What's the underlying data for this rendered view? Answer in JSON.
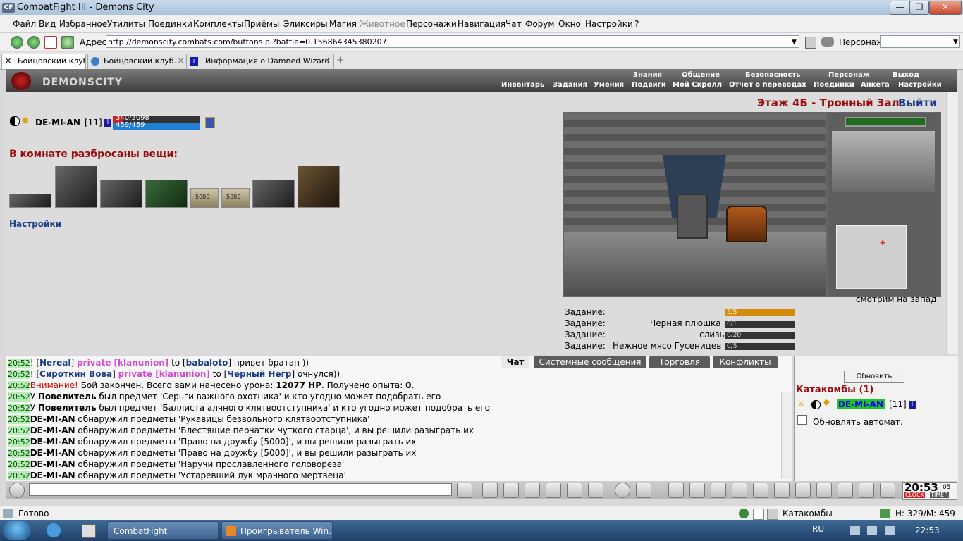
{
  "window": {
    "title": "CombatFight III - Demons City",
    "logo_text": "CF",
    "minimize": "—",
    "maximize": "❐",
    "close": "✕"
  },
  "menu": [
    "Файл",
    "Вид",
    "Избранное",
    "Утилиты",
    "Поединки",
    "Комплекты",
    "Приёмы",
    "Эликсиры",
    "Магия",
    "Животное",
    "Персонажи",
    "Навигация",
    "Чат",
    "Форум",
    "Окно",
    "Настройки",
    "?"
  ],
  "address": {
    "label": "Адрес:",
    "url": "http://demonscity.combats.com/buttons.pl?battle=0.156864345380207",
    "char_label": "Персонаж:"
  },
  "tabs": [
    "Бойцовский клуб",
    "Бойцовский клуб.",
    "Информация о Damned Wizard"
  ],
  "game_header": {
    "logo": "DEMONSCITY",
    "top_links": [
      "Знания",
      "Общение",
      "Безопасность",
      "Персонаж",
      "Выход"
    ],
    "bottom_links": [
      "Инвентарь",
      "Задания",
      "Умения",
      "Подвиги",
      "Мой Скролл",
      "Отчет о переводах",
      "Поединки",
      "Анкета",
      "Настройки"
    ]
  },
  "character": {
    "name": "DE-MI-AN",
    "level": "[11]",
    "hp_text": "340/3098",
    "hp_fraction": 0.11,
    "mp_text": "459/459",
    "info_icon": "i"
  },
  "room": {
    "title": "В комнате разбросаны вещи:",
    "settings_link": "Настройки",
    "scroll_label": "5000"
  },
  "location": {
    "name": "Этаж 4Б - Тронный Зал",
    "exit": "Выйти",
    "facing": "смотрим на запад"
  },
  "tasks": [
    {
      "label": "Задание:",
      "name": "",
      "progress": "5/5",
      "fraction": 1.0
    },
    {
      "label": "Задание:",
      "name": "Черная плюшка",
      "progress": "0/1",
      "fraction": 0
    },
    {
      "label": "Задание:",
      "name": "слизь",
      "progress": "0/20",
      "fraction": 0
    },
    {
      "label": "Задание:",
      "name": "Нежное мясо Гусеницев",
      "progress": "0/5",
      "fraction": 0
    }
  ],
  "chat_tabs": [
    "Чат",
    "Системные сообщения",
    "Торговля",
    "Конфликты"
  ],
  "chat": [
    {
      "time": "20:52",
      "parts": [
        [
          "! [",
          ""
        ],
        [
          "Nereal",
          "bold-blue"
        ],
        [
          "] ",
          ""
        ],
        [
          "private [klanunion]",
          "pink"
        ],
        [
          " to [",
          ""
        ],
        [
          "babaloto",
          "bold-blue"
        ],
        [
          "] привет братан ))",
          ""
        ]
      ]
    },
    {
      "time": "20:52",
      "parts": [
        [
          "! [",
          ""
        ],
        [
          "Сироткин Вова",
          "bold-blue"
        ],
        [
          "] ",
          ""
        ],
        [
          "private [klanunion]",
          "pink"
        ],
        [
          " to [",
          ""
        ],
        [
          "Черный Негр",
          "bold-blue"
        ],
        [
          "] очнулся))",
          ""
        ]
      ]
    },
    {
      "time": "20:52",
      "parts": [
        [
          "Внимание!",
          "red"
        ],
        [
          " Бой закончен. Всего вами нанесено урона: ",
          ""
        ],
        [
          "12077 HP",
          "bold"
        ],
        [
          ". Получено опыта: ",
          ""
        ],
        [
          "0",
          "bold"
        ],
        [
          ".",
          ""
        ]
      ]
    },
    {
      "time": "20:52",
      "parts": [
        [
          "У ",
          ""
        ],
        [
          "Повелитель",
          "bold"
        ],
        [
          " был предмет 'Серьги важного охотника' и кто угодно может подобрать его",
          ""
        ]
      ]
    },
    {
      "time": "20:52",
      "parts": [
        [
          "У ",
          ""
        ],
        [
          "Повелитель",
          "bold"
        ],
        [
          " был предмет 'Баллиста алчного клятвоотступника' и кто угодно может подобрать его",
          ""
        ]
      ]
    },
    {
      "time": "20:52",
      "parts": [
        [
          "DE-MI-AN",
          "bold"
        ],
        [
          " обнаружил предметы 'Рукавицы безвольного клятвоотступника'",
          ""
        ]
      ]
    },
    {
      "time": "20:52",
      "parts": [
        [
          "DE-MI-AN",
          "bold"
        ],
        [
          " обнаружил предметы 'Блестящие перчатки чуткого старца', и вы решили разыграть их",
          ""
        ]
      ]
    },
    {
      "time": "20:52",
      "parts": [
        [
          "DE-MI-AN",
          "bold"
        ],
        [
          " обнаружил предметы 'Право на дружбу [5000]', и вы решили разыграть их",
          ""
        ]
      ]
    },
    {
      "time": "20:52",
      "parts": [
        [
          "DE-MI-AN",
          "bold"
        ],
        [
          " обнаружил предметы 'Право на дружбу [5000]', и вы решили разыграть их",
          ""
        ]
      ]
    },
    {
      "time": "20:52",
      "parts": [
        [
          "DE-MI-AN",
          "bold"
        ],
        [
          " обнаружил предметы 'Наручи прославленного головореза'",
          ""
        ]
      ]
    },
    {
      "time": "20:52",
      "parts": [
        [
          "DE-MI-AN",
          "bold"
        ],
        [
          " обнаружил предметы 'Устаревший лук мрачного мертвеца'",
          ""
        ]
      ]
    }
  ],
  "right_panel": {
    "refresh": "Обновить",
    "title": "Катакомбы (1)",
    "player": "DE-MI-AN",
    "level": "[11]",
    "auto_refresh": "Обновлять автомат."
  },
  "clock": {
    "time": "20:53",
    "seconds": "05",
    "clock_label": "CLOCK",
    "timer_label": "TIMER"
  },
  "status": {
    "ready": "Готово",
    "zone": "Катакомбы",
    "hp": "Н: 329/М: 459"
  },
  "taskbar": {
    "buttons": [
      "CombatFight",
      "Проигрыватель Win..."
    ],
    "lang": "RU",
    "time": "22:53"
  },
  "colors": {
    "accent_red": "#9b0d0d",
    "link_blue": "#1c3e8a",
    "timestamp_bg": "#b6efb6"
  }
}
